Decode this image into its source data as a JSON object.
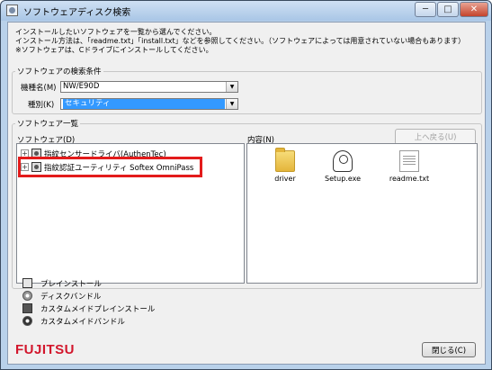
{
  "window": {
    "title": "ソフトウェアディスク検索",
    "controls": {
      "minimize": "─",
      "maximize": "□",
      "close": "✕"
    }
  },
  "intro_lines": [
    "インストールしたいソフトウェアを一覧から選んでください。",
    "インストール方法は、「readme.txt」「install.txt」などを参照してください。（ソフトウェアによっては用意されていない場合もあります）",
    "※ソフトウェアは、Cドライブにインストールしてください。"
  ],
  "search": {
    "group_label": "ソフトウェアの検索条件",
    "model_label": "機種名(M)",
    "model_value": "NW/E90D",
    "type_label": "種別(K)",
    "type_value": "セキュリティ"
  },
  "list": {
    "group_label": "ソフトウェア一覧",
    "tree_label": "ソフトウェア(D)",
    "tree_items": [
      {
        "label": "指紋センサードライバ(AuthenTec)"
      },
      {
        "label": "指紋認証ユーティリティ Softex OmniPass"
      }
    ],
    "content_label": "内容(N)",
    "up_button": "上へ戻る(U)",
    "files": [
      {
        "name": "driver",
        "icon": "folder-icon"
      },
      {
        "name": "Setup.exe",
        "icon": "setup-exe-icon"
      },
      {
        "name": "readme.txt",
        "icon": "text-file-icon"
      }
    ]
  },
  "legend": [
    {
      "label": "プレインストール",
      "icon": "preinstall-icon"
    },
    {
      "label": "ディスクバンドル",
      "icon": "disc-bundle-icon"
    },
    {
      "label": "カスタムメイドプレインストール",
      "icon": "custom-preinstall-icon"
    },
    {
      "label": "カスタムメイドバンドル",
      "icon": "custom-bundle-icon"
    }
  ],
  "brand": {
    "logo": "FUJITSU",
    "color": "#d2162c"
  },
  "close_button": "閉じる(C)",
  "colors": {
    "highlight": "#e31b1b",
    "selection": "#3399ff"
  }
}
